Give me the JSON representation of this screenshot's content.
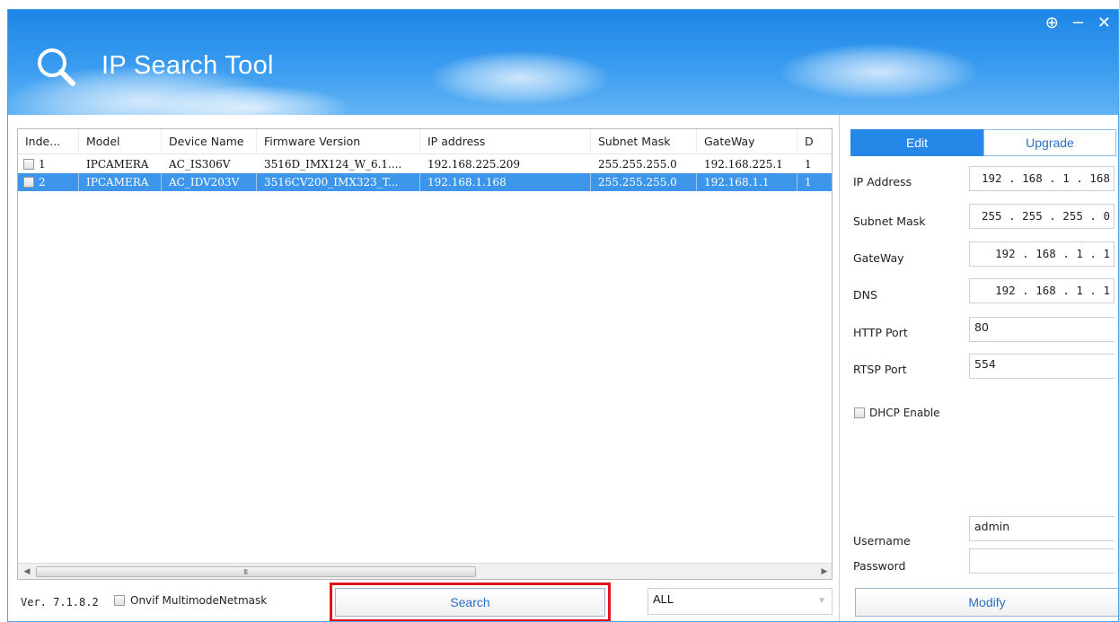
{
  "window": {
    "title": "IP Search Tool",
    "controls": [
      "⊕",
      "−",
      "✕"
    ]
  },
  "table": {
    "columns": [
      "Inde...",
      "Model",
      "Device Name",
      "Firmware Version",
      "IP address",
      "Subnet Mask",
      "GateWay",
      "D"
    ],
    "rows": [
      {
        "index": "1",
        "model": "IPCAMERA",
        "device_name": "AC_IS306V",
        "firmware": "3516D_IMX124_W_6.1....",
        "ip": "192.168.225.209",
        "mask": "255.255.255.0",
        "gateway": "192.168.225.1",
        "d": "1",
        "selected": false
      },
      {
        "index": "2",
        "model": "IPCAMERA",
        "device_name": "AC_IDV203V",
        "firmware": "3516CV200_IMX323_T...",
        "ip": "192.168.1.168",
        "mask": "255.255.255.0",
        "gateway": "192.168.1.1",
        "d": "1",
        "selected": true
      }
    ],
    "scroll_grip": "III"
  },
  "bottom": {
    "version": "Ver. 7.1.8.2",
    "onvif_label": "Onvif MultimodeNetmask",
    "search_label": "Search",
    "filter_value": "ALL"
  },
  "panel": {
    "tab_edit": "Edit",
    "tab_upgrade": "Upgrade",
    "ip_address_label": "IP Address",
    "ip_address_value": "192 . 168 .  1  . 168",
    "subnet_mask_label": "Subnet Mask",
    "subnet_mask_value": "255 . 255 . 255 .  0",
    "gateway_label": "GateWay",
    "gateway_value": "192 . 168 .  1  .  1",
    "dns_label": "DNS",
    "dns_value": "192 . 168 .  1  .  1",
    "http_port_label": "HTTP Port",
    "http_port_value": "80",
    "rtsp_port_label": "RTSP Port",
    "rtsp_port_value": "554",
    "dhcp_label": "DHCP Enable",
    "username_label": "Username",
    "username_value": "admin",
    "password_label": "Password",
    "password_value": "",
    "modify_label": "Modify"
  },
  "colors": {
    "header_blue": "#1d86e6",
    "selection_blue": "#3d96ea",
    "tab_active": "#2587e8",
    "highlight_red": "#e0141b",
    "button_text": "#2b6fc2"
  }
}
